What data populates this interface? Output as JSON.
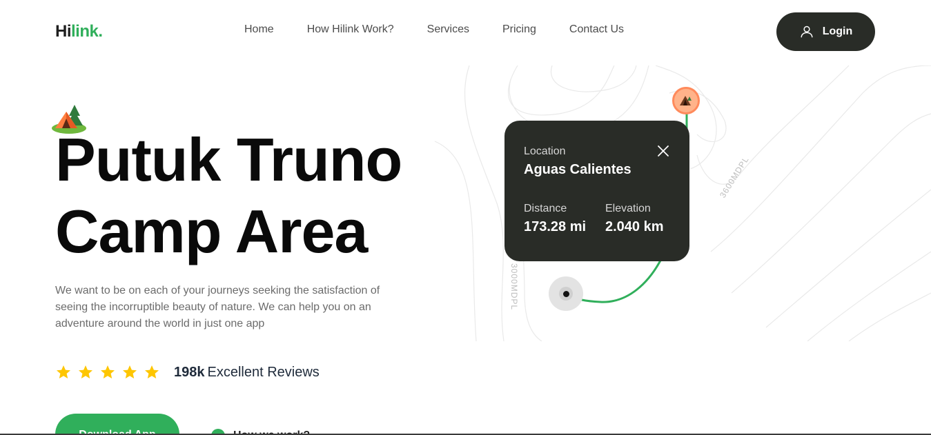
{
  "header": {
    "logo_prefix": "Hi",
    "logo_suffix": "link.",
    "nav": [
      {
        "label": "Home"
      },
      {
        "label": "How Hilink Work?"
      },
      {
        "label": "Services"
      },
      {
        "label": "Pricing"
      },
      {
        "label": "Contact Us"
      }
    ],
    "login_label": "Login",
    "login_icon": "user-icon"
  },
  "hero": {
    "title_line1": "Putuk Truno",
    "title_line2": "Camp Area",
    "camp_icon": "camp-tent-icon",
    "description": "We want to be on each of your journeys seeking the satisfaction of seeing the incorruptible beauty of nature. We can help you on an adventure around the world in just one app",
    "rating": {
      "stars": 5,
      "max_stars": 5,
      "count": "198k",
      "label": "Excellent Reviews"
    },
    "primary_button": "Download App",
    "secondary_link": "How we work?"
  },
  "map_card": {
    "location_label": "Location",
    "location_value": "Aguas Calientes",
    "distance_label": "Distance",
    "distance_value": "173.28 mi",
    "elevation_label": "Elevation",
    "elevation_value": "2.040 km",
    "close_icon": "close-icon"
  },
  "map": {
    "contour_label_1": "3600MDPL",
    "contour_label_2": "3000MDPL",
    "route_color": "#30af5b"
  },
  "colors": {
    "brand_green": "#30af5b",
    "dark": "#292c27",
    "star": "#fec601",
    "pin": "#ff8a5b"
  }
}
